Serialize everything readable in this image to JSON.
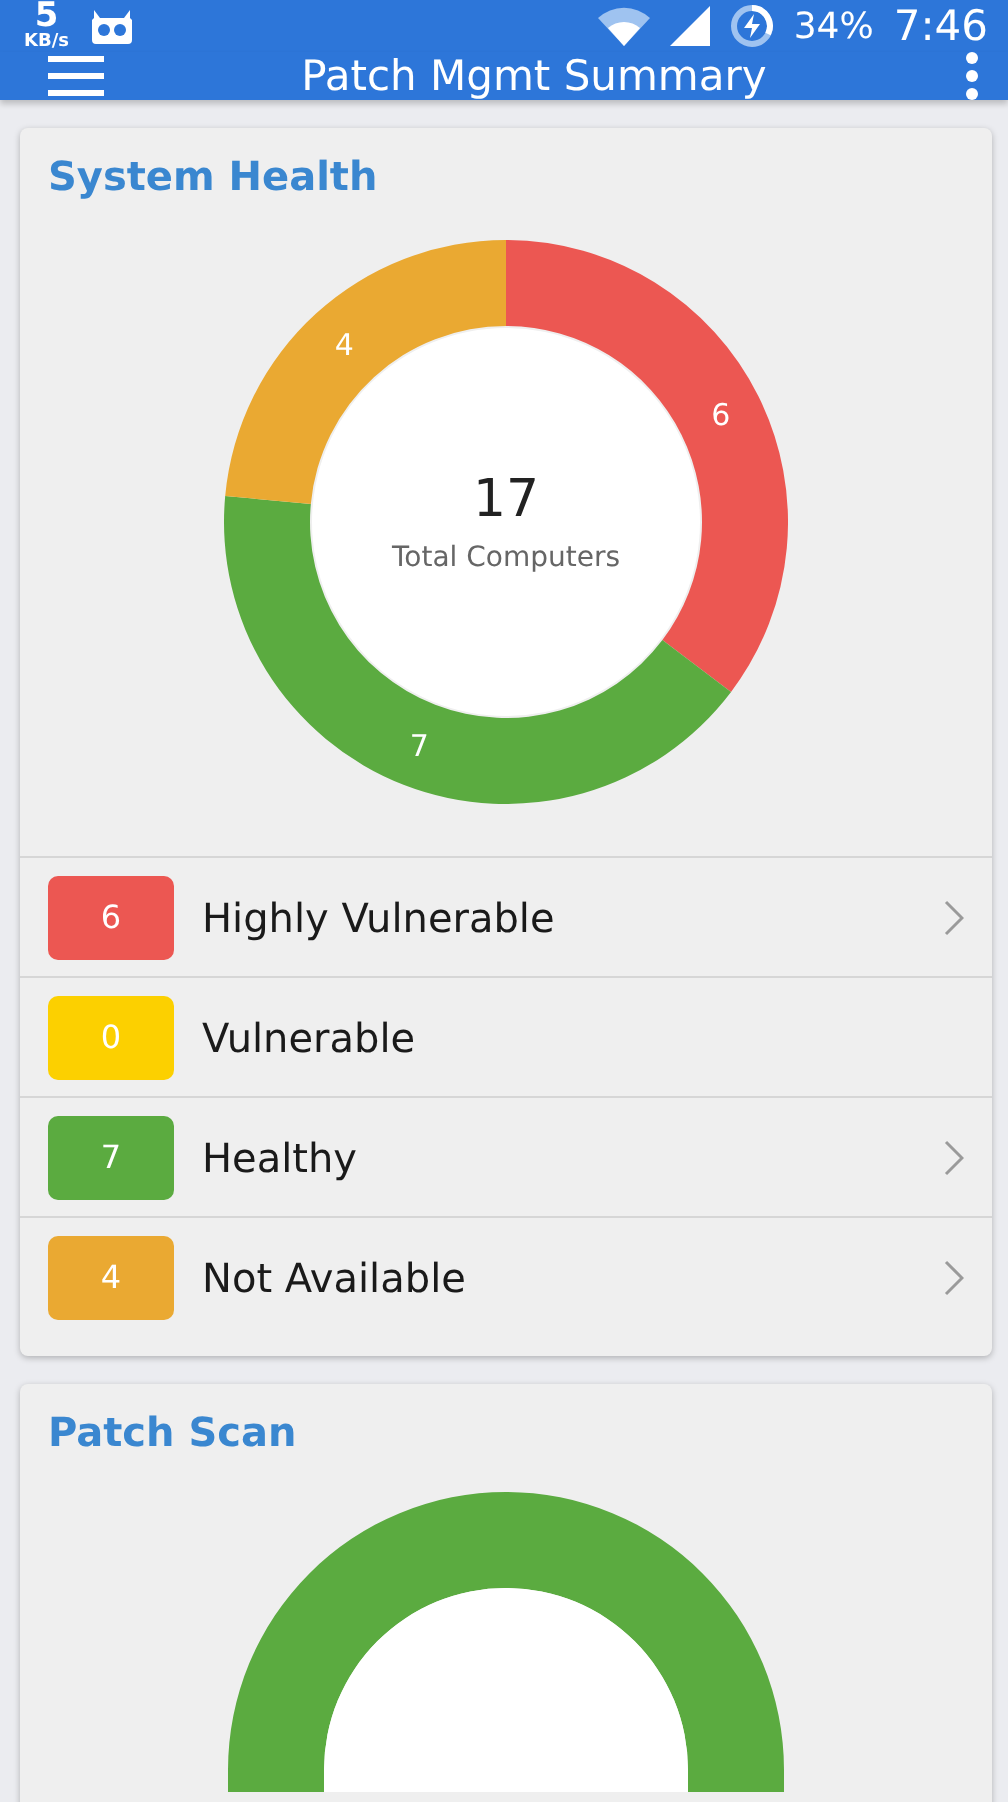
{
  "status_bar": {
    "speed": "5",
    "speed_unit": "KB/s",
    "battery": "34%",
    "time": "7:46"
  },
  "app_bar": {
    "title": "Patch Mgmt Summary"
  },
  "system_health": {
    "title": "System Health",
    "center_value": "17",
    "center_label": "Total Computers",
    "chart_data": {
      "type": "donut",
      "values": [
        6,
        0,
        7,
        4
      ],
      "data_labels": true
    },
    "legend": [
      {
        "count": "6",
        "label": "Highly Vulnerable",
        "color": "#ec5752",
        "chevron": true
      },
      {
        "count": "0",
        "label": "Vulnerable",
        "color": "#fcd000",
        "chevron": false
      },
      {
        "count": "7",
        "label": "Healthy",
        "color": "#5bab40",
        "chevron": true
      },
      {
        "count": "4",
        "label": "Not Available",
        "color": "#eaa932",
        "chevron": true
      }
    ]
  },
  "patch_scan": {
    "title": "Patch Scan"
  }
}
